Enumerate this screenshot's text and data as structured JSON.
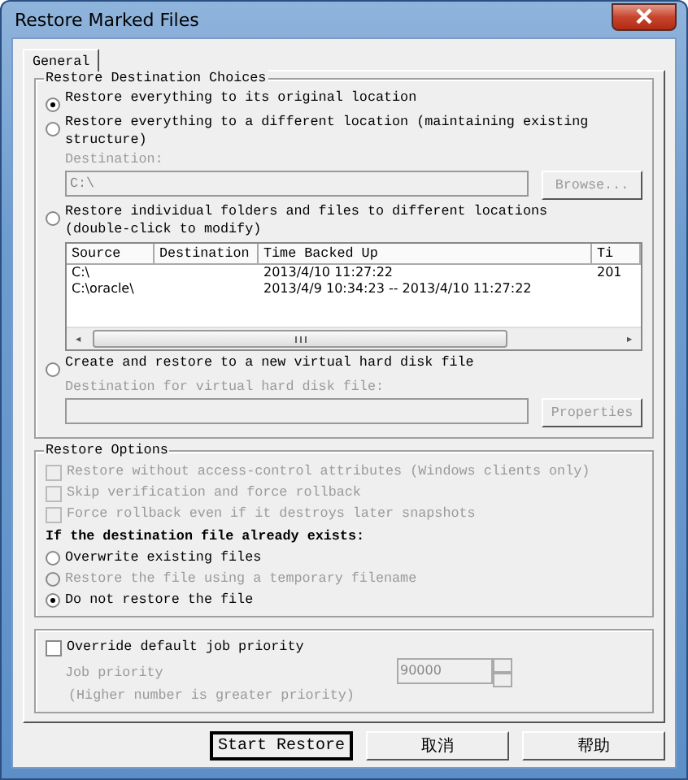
{
  "window": {
    "title": "Restore Marked Files"
  },
  "tabs": [
    {
      "label": "General",
      "selected": true
    }
  ],
  "destination_choices": {
    "title": "Restore Destination Choices",
    "options": [
      {
        "kind": "plain",
        "label": "Restore everything to its original location",
        "selected": true
      },
      {
        "kind": "path",
        "label": "Restore everything to a different location (maintaining existing structure)",
        "selected": false,
        "field_label": "Destination:",
        "value": "C:\\",
        "button": "Browse...",
        "disabled": true
      },
      {
        "kind": "table",
        "label": "Restore individual folders and files to different locations (double-click to modify)",
        "selected": false,
        "columns": [
          "Source",
          "Destination",
          "Time Backed Up",
          "Ti"
        ],
        "rows": [
          {
            "source": "C:\\",
            "time": "2013/4/10 11:27:22",
            "column_4": "201"
          },
          {
            "source": "C:\\oracle\\",
            "time": "2013/4/9 10:34:23 -- 2013/4/10 11:27:22"
          }
        ],
        "scrollbar_arrows": [
          "◂",
          "▸"
        ]
      },
      {
        "kind": "path",
        "label": "Create and restore to a new virtual hard disk file",
        "selected": false,
        "field_label": "Destination for virtual hard disk file:",
        "button": "Properties",
        "disabled": true
      }
    ]
  },
  "restore_options": {
    "title": "Restore Options",
    "checkboxes": [
      {
        "label": "Restore without access-control attributes (Windows clients only)",
        "checked": false,
        "disabled": true
      },
      {
        "label": "Skip verification and force rollback",
        "checked": false,
        "disabled": true
      },
      {
        "label": "Force rollback even if it destroys later snapshots",
        "checked": false,
        "disabled": true
      }
    ],
    "exists_label": "If the destination file already exists:",
    "radios": [
      {
        "label": "Overwrite existing files",
        "selected": false,
        "disabled": false
      },
      {
        "label": "Restore the file using a temporary filename",
        "selected": false,
        "disabled": true
      },
      {
        "label": "Do not restore the file",
        "selected": true,
        "disabled": false
      }
    ]
  },
  "priority": {
    "checkbox": {
      "label": "Override default job priority",
      "checked": false
    },
    "label": "Job priority",
    "value": "90000",
    "note": "(Higher number is greater priority)",
    "disabled": true
  },
  "buttons": [
    {
      "label": "Start Restore",
      "default": true
    },
    {
      "label": "取消",
      "default": false
    },
    {
      "label": "帮助",
      "default": false
    }
  ]
}
